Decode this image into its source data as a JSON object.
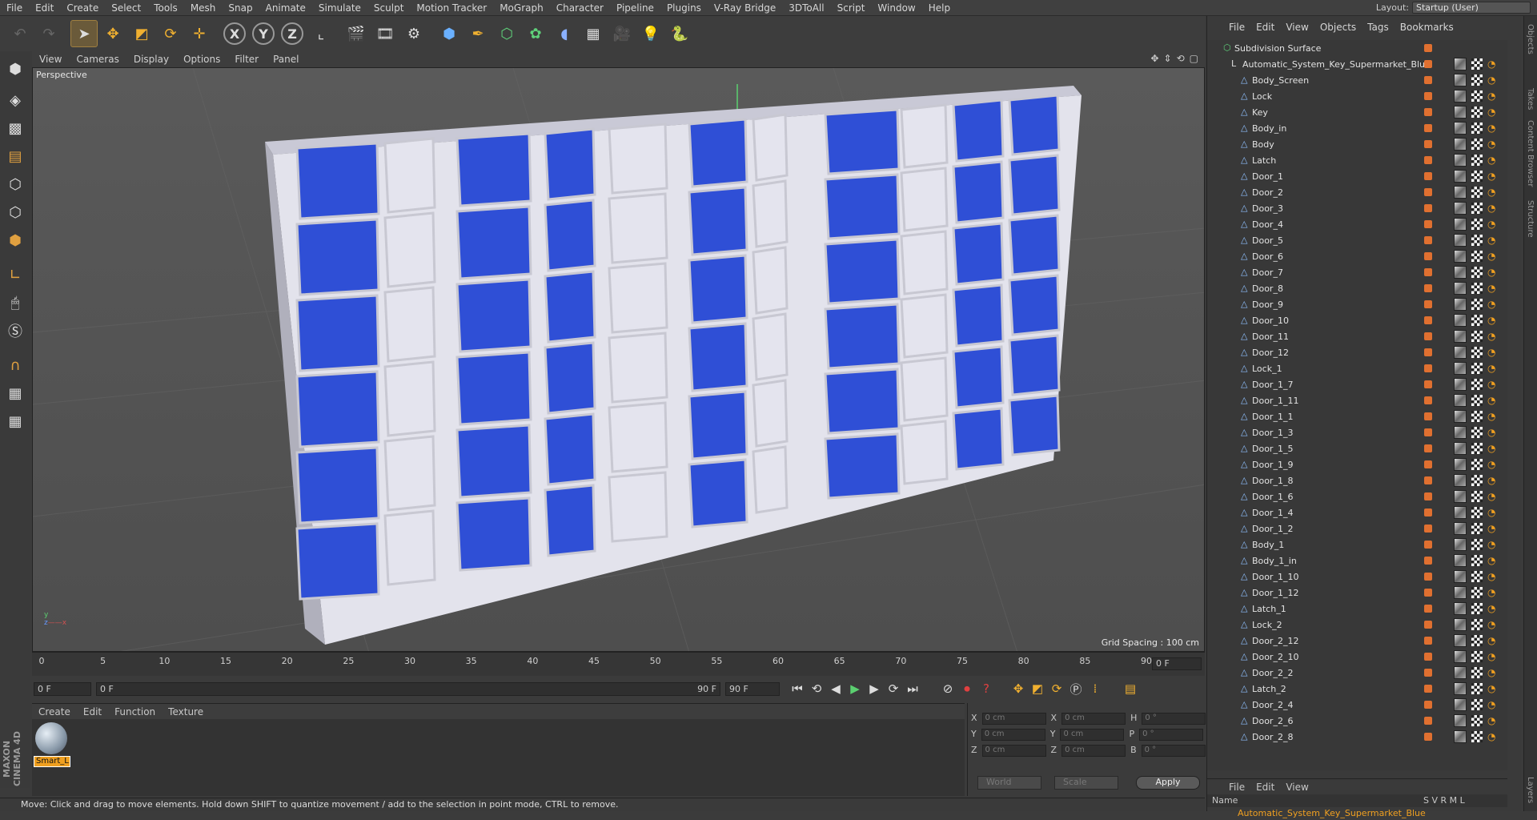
{
  "menu": [
    "File",
    "Edit",
    "Create",
    "Select",
    "Tools",
    "Mesh",
    "Snap",
    "Animate",
    "Simulate",
    "Sculpt",
    "Motion Tracker",
    "MoGraph",
    "Character",
    "Pipeline",
    "Plugins",
    "V-Ray Bridge",
    "3DToAll",
    "Script",
    "Window",
    "Help"
  ],
  "layout": {
    "label": "Layout:",
    "value": "Startup (User)"
  },
  "viewport": {
    "menu": [
      "View",
      "Cameras",
      "Display",
      "Options",
      "Filter",
      "Panel"
    ],
    "camera": "Perspective",
    "grid_spacing": "Grid Spacing : 100 cm"
  },
  "timeline": {
    "ticks": [
      "0",
      "5",
      "10",
      "15",
      "20",
      "25",
      "30",
      "35",
      "40",
      "45",
      "50",
      "55",
      "60",
      "65",
      "70",
      "75",
      "80",
      "85",
      "90"
    ],
    "frame": "0 F"
  },
  "playbar": {
    "start": "0 F",
    "range_start": "0 F",
    "range_end": "90 F",
    "end": "90 F"
  },
  "material_menu": [
    "Create",
    "Edit",
    "Function",
    "Texture"
  ],
  "material": {
    "name": "Smart_L"
  },
  "coords": {
    "rows": [
      {
        "a": "X",
        "av": "0 cm",
        "b": "X",
        "bv": "0 cm",
        "c": "H",
        "cv": "0 °"
      },
      {
        "a": "Y",
        "av": "0 cm",
        "b": "Y",
        "bv": "0 cm",
        "c": "P",
        "cv": "0 °"
      },
      {
        "a": "Z",
        "av": "0 cm",
        "b": "Z",
        "bv": "0 cm",
        "c": "B",
        "cv": "0 °"
      }
    ],
    "world": "World",
    "scale": "Scale",
    "apply": "Apply"
  },
  "status": "Move: Click and drag to move elements. Hold down SHIFT to quantize movement / add to the selection in point mode, CTRL to remove.",
  "brand": "MAXON CINEMA 4D",
  "object_manager": {
    "menu": [
      "File",
      "Edit",
      "View",
      "Objects",
      "Tags",
      "Bookmarks"
    ],
    "root": "Subdivision Surface",
    "group": "Automatic_System_Key_Supermarket_Blue",
    "objects": [
      "Body_Screen",
      "Lock",
      "Key",
      "Body_in",
      "Body",
      "Latch",
      "Door_1",
      "Door_2",
      "Door_3",
      "Door_4",
      "Door_5",
      "Door_6",
      "Door_7",
      "Door_8",
      "Door_9",
      "Door_10",
      "Door_11",
      "Door_12",
      "Lock_1",
      "Door_1_7",
      "Door_1_11",
      "Door_1_1",
      "Door_1_3",
      "Door_1_5",
      "Door_1_9",
      "Door_1_8",
      "Door_1_6",
      "Door_1_4",
      "Door_1_2",
      "Body_1",
      "Body_1_in",
      "Door_1_10",
      "Door_1_12",
      "Latch_1",
      "Lock_2",
      "Door_2_12",
      "Door_2_10",
      "Door_2_2",
      "Latch_2",
      "Door_2_4",
      "Door_2_6",
      "Door_2_8"
    ]
  },
  "layer_manager": {
    "menu": [
      "File",
      "Edit",
      "View"
    ],
    "name_header": "Name",
    "cols": "S V R M L",
    "layer": "Automatic_System_Key_Supermarket_Blue"
  },
  "side_tabs": [
    "Objects",
    "Takes",
    "Content Browser",
    "Structure",
    "Layers"
  ]
}
